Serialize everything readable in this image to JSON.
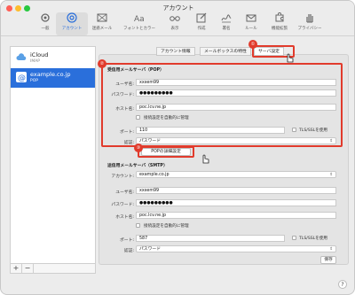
{
  "window": {
    "title": "アカウント"
  },
  "toolbar": {
    "items": [
      {
        "label": "一般",
        "icon": "gear-icon"
      },
      {
        "label": "アカウント",
        "icon": "at-icon"
      },
      {
        "label": "迷惑メール",
        "icon": "junk-mail-icon"
      },
      {
        "label": "フォントとカラー",
        "icon": "font-icon"
      },
      {
        "label": "表示",
        "icon": "glasses-icon"
      },
      {
        "label": "作成",
        "icon": "compose-icon"
      },
      {
        "label": "署名",
        "icon": "signature-icon"
      },
      {
        "label": "ルール",
        "icon": "rules-icon"
      },
      {
        "label": "機能拡張",
        "icon": "puzzle-icon"
      },
      {
        "label": "プライバシー",
        "icon": "hand-icon"
      }
    ]
  },
  "sidebar": {
    "accounts": [
      {
        "name": "iCloud",
        "type": "IMAP"
      },
      {
        "name": "example.co.jp",
        "type": "POP"
      }
    ],
    "add_label": "+",
    "remove_label": "−"
  },
  "tabs": [
    "アカウント情報",
    "メールボックスの特性",
    "サーバ設定"
  ],
  "incoming": {
    "heading": "受信用メールサーバ（POP）",
    "user_label": "ユーザ名:",
    "user_value": "xxxem99",
    "password_label": "パスワード:",
    "password_value": "●●●●●●●●●",
    "host_label": "ホスト名:",
    "host_value": "poc.lcv.ne.jp",
    "auto_label": "接続設定を自動的に管理",
    "port_label": "ポート:",
    "port_value": "110",
    "tls_label": "TLS/SSLを使用",
    "auth_label": "認証:",
    "auth_value": "パスワード",
    "advanced_button": "POPの詳細設定"
  },
  "outgoing": {
    "heading": "送信用メールサーバ（SMTP）",
    "account_label": "アカウント:",
    "account_value": "example.co.jp",
    "user_label": "ユーザ名:",
    "user_value": "xxxem99",
    "password_label": "パスワード:",
    "password_value": "●●●●●●●●●",
    "host_label": "ホスト名:",
    "host_value": "poc.lcv.ne.jp",
    "auto_label": "接続設定を自動的に管理",
    "port_label": "ポート:",
    "port_value": "587",
    "tls_label": "TLS/SSLを使用",
    "auth_label": "認証:",
    "auth_value": "パスワード",
    "save_button": "保存"
  },
  "annotations": {
    "badge1": "①",
    "badge2": "②",
    "badge3": "③"
  },
  "help_label": "?",
  "colors": {
    "accent": "#2a6fdb",
    "highlight": "#e13b2c"
  }
}
